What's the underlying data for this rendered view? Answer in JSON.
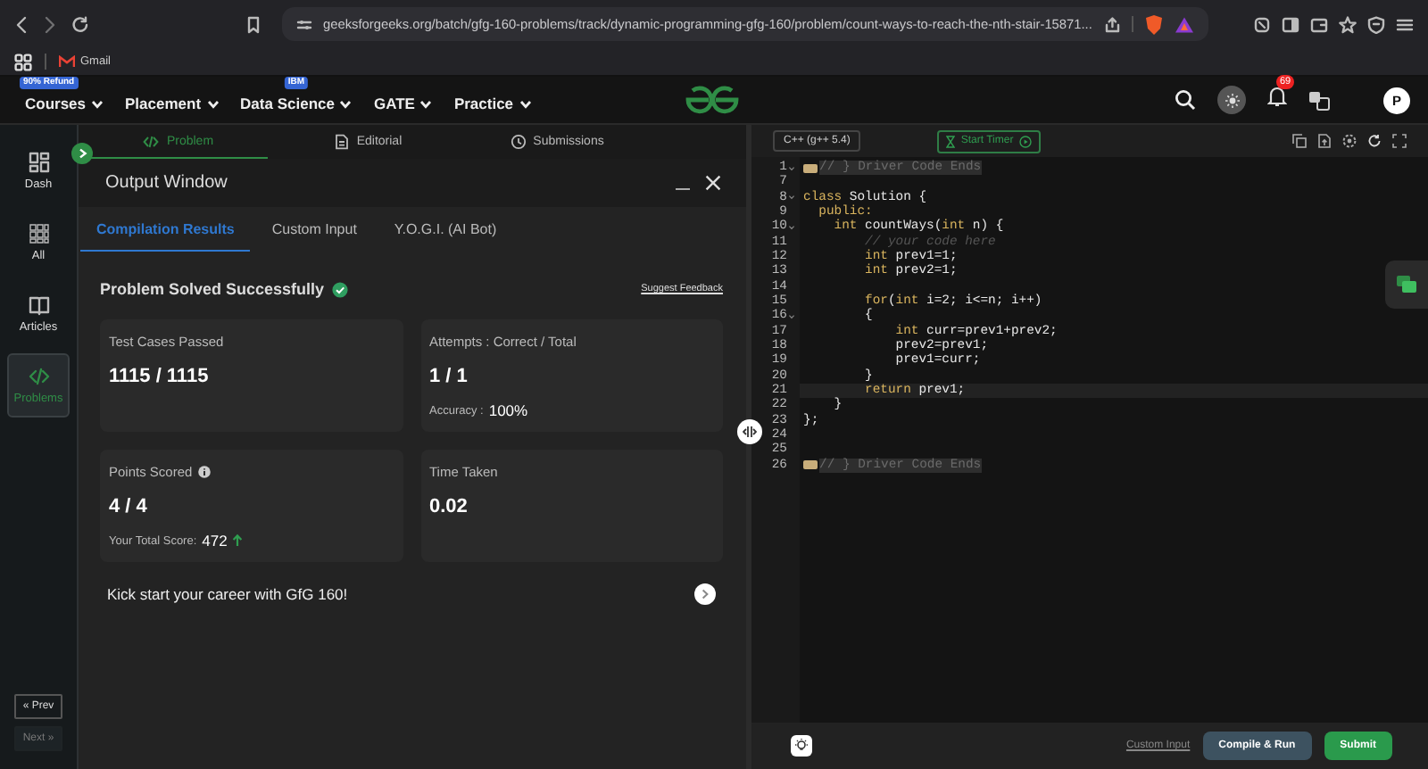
{
  "browser": {
    "url": "geeksforgeeks.org/batch/gfg-160-problems/track/dynamic-programming-gfg-160/problem/count-ways-to-reach-the-nth-stair-15871...",
    "bookmarks": [
      {
        "label": "Gmail"
      }
    ]
  },
  "site_nav": {
    "items": [
      {
        "label": "Courses",
        "badge": "90% Refund"
      },
      {
        "label": "Placement"
      },
      {
        "label": "Data Science",
        "badge": "IBM"
      },
      {
        "label": "GATE"
      },
      {
        "label": "Practice"
      }
    ],
    "notification_count": "69",
    "avatar_initial": "P"
  },
  "sidebar": {
    "items": [
      {
        "label": "Dash",
        "selected": false
      },
      {
        "label": "All",
        "selected": false
      },
      {
        "label": "Articles",
        "selected": false
      },
      {
        "label": "Problems",
        "selected": true
      }
    ],
    "pager": [
      {
        "label": "« Prev",
        "disabled": false
      },
      {
        "label": "Next »",
        "disabled": true
      }
    ]
  },
  "problem_tabs": [
    {
      "label": "Problem",
      "selected": true
    },
    {
      "label": "Editorial",
      "selected": false
    },
    {
      "label": "Submissions",
      "selected": false
    }
  ],
  "output_window": {
    "title": "Output Window",
    "tabs": [
      {
        "label": "Compilation Results",
        "selected": true
      },
      {
        "label": "Custom Input",
        "selected": false
      },
      {
        "label": "Y.O.G.I. (AI Bot)",
        "selected": false
      }
    ],
    "status": "Problem Solved Successfully",
    "feedback_link": "Suggest Feedback",
    "cards": [
      {
        "label": "Test Cases Passed",
        "value": "1115 / 1115"
      },
      {
        "label": "Attempts : Correct / Total",
        "value": "1 / 1",
        "detail_label": "Accuracy :",
        "detail_value": "100%"
      },
      {
        "label": "Points Scored",
        "info": true,
        "value": "4 / 4",
        "detail_label": "Your Total Score:",
        "detail_value": "472",
        "rising": true
      },
      {
        "label": "Time Taken",
        "value": "0.02"
      }
    ],
    "promo": "Kick start your career with GfG 160!"
  },
  "editor": {
    "language": "C++ (g++ 5.4)",
    "timer_button": "Start Timer",
    "lines": [
      {
        "number": "1",
        "kind": "folded",
        "foldable": true,
        "active": false,
        "text": "// } Driver Code Ends"
      },
      {
        "number": "7",
        "kind": "code",
        "foldable": false,
        "active": false
      },
      {
        "number": "8",
        "kind": "code",
        "foldable": true,
        "active": false,
        "segments": [
          {
            "text": "class",
            "kind": "keyword"
          },
          {
            "text": " Solution {",
            "kind": "plain"
          }
        ]
      },
      {
        "number": "9",
        "kind": "code",
        "foldable": false,
        "active": false,
        "segments": [
          {
            "text": "  public:",
            "kind": "keyword"
          }
        ]
      },
      {
        "number": "10",
        "kind": "code",
        "foldable": true,
        "active": false,
        "segments": [
          {
            "text": "    int",
            "kind": "keyword"
          },
          {
            "text": " countWays(",
            "kind": "plain"
          },
          {
            "text": "int",
            "kind": "keyword"
          },
          {
            "text": " n) {",
            "kind": "plain"
          }
        ]
      },
      {
        "number": "11",
        "kind": "code",
        "foldable": false,
        "active": false,
        "segments": [
          {
            "text": "        // your code here",
            "kind": "comment"
          }
        ]
      },
      {
        "number": "12",
        "kind": "code",
        "foldable": false,
        "active": false,
        "segments": [
          {
            "text": "        int",
            "kind": "keyword"
          },
          {
            "text": " prev1=1;",
            "kind": "plain"
          }
        ]
      },
      {
        "number": "13",
        "kind": "code",
        "foldable": false,
        "active": false,
        "segments": [
          {
            "text": "        int",
            "kind": "keyword"
          },
          {
            "text": " prev2=1;",
            "kind": "plain"
          }
        ]
      },
      {
        "number": "14",
        "kind": "code",
        "foldable": false,
        "active": false
      },
      {
        "number": "15",
        "kind": "code",
        "foldable": false,
        "active": false,
        "segments": [
          {
            "text": "        for",
            "kind": "keyword"
          },
          {
            "text": "(",
            "kind": "plain"
          },
          {
            "text": "int",
            "kind": "keyword"
          },
          {
            "text": " i=2; i<=n; i++)",
            "kind": "plain"
          }
        ]
      },
      {
        "number": "16",
        "kind": "code",
        "foldable": true,
        "active": false,
        "segments": [
          {
            "text": "        {",
            "kind": "plain"
          }
        ]
      },
      {
        "number": "17",
        "kind": "code",
        "foldable": false,
        "active": false,
        "segments": [
          {
            "text": "            int",
            "kind": "keyword"
          },
          {
            "text": " curr=prev1+prev2;",
            "kind": "plain"
          }
        ]
      },
      {
        "number": "18",
        "kind": "code",
        "foldable": false,
        "active": false,
        "segments": [
          {
            "text": "            prev2=prev1;",
            "kind": "plain"
          }
        ]
      },
      {
        "number": "19",
        "kind": "code",
        "foldable": false,
        "active": false,
        "segments": [
          {
            "text": "            prev1=curr;",
            "kind": "plain"
          }
        ]
      },
      {
        "number": "20",
        "kind": "code",
        "foldable": false,
        "active": false,
        "segments": [
          {
            "text": "        }",
            "kind": "plain"
          }
        ]
      },
      {
        "number": "21",
        "kind": "code",
        "foldable": false,
        "active": true,
        "segments": [
          {
            "text": "        return",
            "kind": "keyword"
          },
          {
            "text": " prev1;",
            "kind": "plain"
          }
        ]
      },
      {
        "number": "22",
        "kind": "code",
        "foldable": false,
        "active": false,
        "segments": [
          {
            "text": "    }",
            "kind": "plain"
          }
        ]
      },
      {
        "number": "23",
        "kind": "code",
        "foldable": false,
        "active": false,
        "segments": [
          {
            "text": "};",
            "kind": "plain"
          }
        ]
      },
      {
        "number": "24",
        "kind": "code",
        "foldable": false,
        "active": false
      },
      {
        "number": "25",
        "kind": "code",
        "foldable": false,
        "active": false
      },
      {
        "number": "26",
        "kind": "folded",
        "foldable": false,
        "active": false,
        "text": "// } Driver Code Ends"
      }
    ],
    "custom_input_link": "Custom Input",
    "compile_button": "Compile & Run",
    "submit_button": "Submit"
  }
}
